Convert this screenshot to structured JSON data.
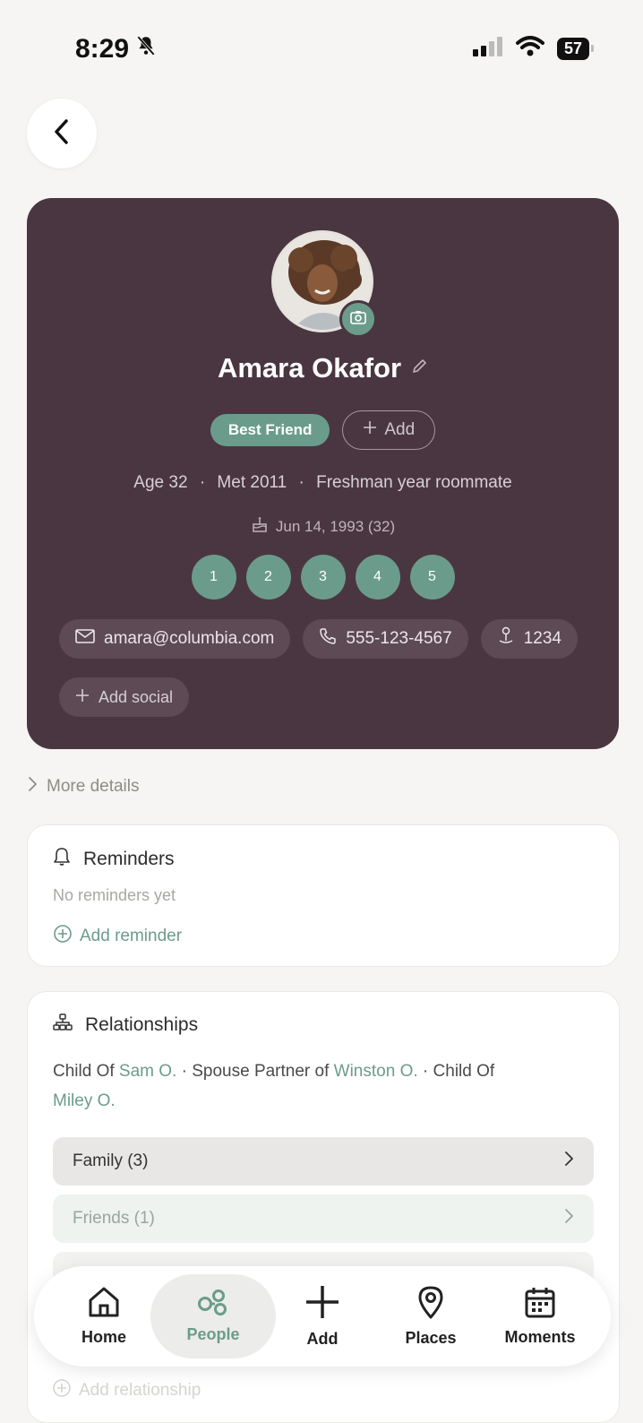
{
  "status_bar": {
    "time": "8:29",
    "battery": "57"
  },
  "profile": {
    "name": "Amara Okafor",
    "tag": "Best Friend",
    "add_tag_label": "Add",
    "age": "Age 32",
    "met": "Met 2011",
    "how_met": "Freshman year roommate",
    "separator": "·",
    "birthday": "Jun 14, 1993 (32)",
    "rating_dots": [
      "1",
      "2",
      "3",
      "4",
      "5"
    ],
    "contacts": {
      "email": "amara@columbia.com",
      "phone": "555-123-4567",
      "address": "1234"
    },
    "add_social_label": "Add social"
  },
  "more_details_label": "More details",
  "reminders": {
    "title": "Reminders",
    "empty_text": "No reminders yet",
    "add_label": "Add reminder"
  },
  "relationships": {
    "title": "Relationships",
    "rel1_type": "Child Of",
    "rel1_name": "Sam O.",
    "rel2_type": "Spouse Partner of",
    "rel2_name": "Winston O.",
    "rel3_type": "Child Of",
    "rel3_name": "Miley O.",
    "groups": [
      {
        "label": "Family (3)"
      },
      {
        "label": "Friends (1)"
      }
    ],
    "add_label": "Add relationship"
  },
  "nav": {
    "home": "Home",
    "people": "People",
    "add": "Add",
    "places": "Places",
    "moments": "Moments",
    "active": "people"
  },
  "colors": {
    "card_bg": "#4a3641",
    "accent_green": "#6b9c8b",
    "page_bg": "#f6f5f3"
  }
}
